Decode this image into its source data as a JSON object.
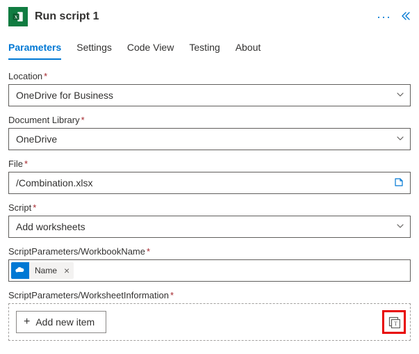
{
  "header": {
    "title": "Run script 1",
    "icon_text": "x"
  },
  "tabs": [
    {
      "label": "Parameters",
      "active": true
    },
    {
      "label": "Settings",
      "active": false
    },
    {
      "label": "Code View",
      "active": false
    },
    {
      "label": "Testing",
      "active": false
    },
    {
      "label": "About",
      "active": false
    }
  ],
  "fields": {
    "location": {
      "label": "Location",
      "value": "OneDrive for Business"
    },
    "doclib": {
      "label": "Document Library",
      "value": "OneDrive"
    },
    "file": {
      "label": "File",
      "value": "/Combination.xlsx"
    },
    "script": {
      "label": "Script",
      "value": "Add worksheets"
    },
    "workbook": {
      "label": "ScriptParameters/WorkbookName",
      "token": "Name"
    },
    "worksheet": {
      "label": "ScriptParameters/WorksheetInformation",
      "add_label": "Add new item"
    }
  }
}
